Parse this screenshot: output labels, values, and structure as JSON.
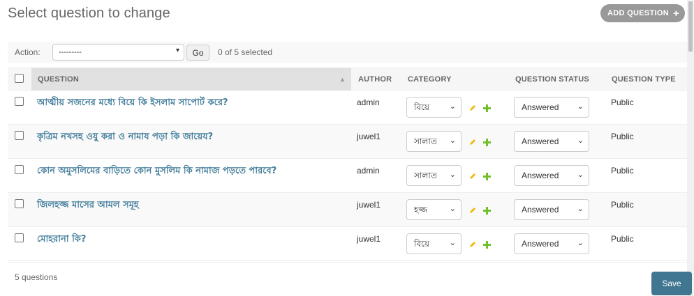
{
  "page": {
    "title": "Select question to change",
    "add_button": "ADD QUESTION",
    "add_icon": "+"
  },
  "actions": {
    "label": "Action:",
    "selected_option": "---------",
    "go_label": "Go",
    "selected_count": "0 of 5 selected"
  },
  "table": {
    "headers": [
      "QUESTION",
      "AUTHOR",
      "CATEGORY",
      "QUESTION STATUS",
      "QUESTION TYPE"
    ],
    "rows": [
      {
        "question": "আত্মীয় সজনের মধ্যে বিয়ে কি ইসলাম সাপোর্ট করে?",
        "author": "admin",
        "category": "বিয়ে",
        "status": "Answered",
        "type": "Public"
      },
      {
        "question": "কৃত্রিম নখসহ ওযু করা ও নামায পড়া কি জায়েয?",
        "author": "juwel1",
        "category": "সালাত",
        "status": "Answered",
        "type": "Public"
      },
      {
        "question": "কোন অমুসলিমের বাড়িতে কোন মুসলিম কি নামাজ পড়তে পারবে?",
        "author": "admin",
        "category": "সালাত",
        "status": "Answered",
        "type": "Public"
      },
      {
        "question": "জিলহজ্জ মাসের আমল সমূহ",
        "author": "juwel1",
        "category": "হজ্জ",
        "status": "Answered",
        "type": "Public"
      },
      {
        "question": "মোহরানা কি?",
        "author": "juwel1",
        "category": "বিয়ে",
        "status": "Answered",
        "type": "Public"
      }
    ]
  },
  "footer": {
    "count": "5 questions",
    "save_label": "Save"
  },
  "colors": {
    "link": "#447e9b",
    "save_button": "#417690",
    "add_button": "#999999",
    "change_icon": "#efb80b",
    "add_icon": "#70bf2b"
  },
  "icons": [
    "plus-icon",
    "pencil-icon",
    "chevron-down-icon",
    "sort-up-icon"
  ]
}
